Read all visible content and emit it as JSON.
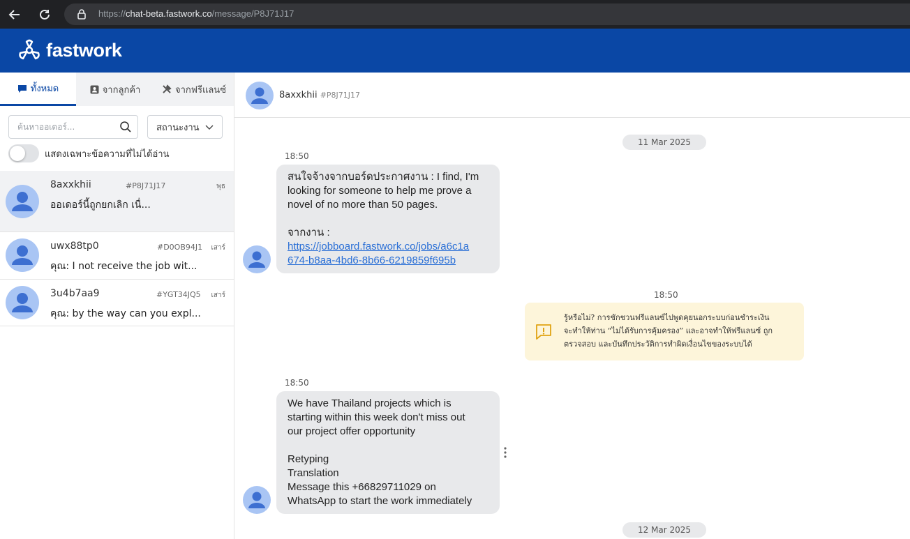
{
  "browser": {
    "url_scheme": "https://",
    "url_host": "chat-beta.fastwork.co",
    "url_path": "/message/P8J71J17"
  },
  "app": {
    "logo_text": "fastwork",
    "brand_color": "#0a47a5"
  },
  "sidebar": {
    "tabs": [
      {
        "label": "ทั้งหมด",
        "icon": "chat-icon",
        "active": true
      },
      {
        "label": "จากลูกค้า",
        "icon": "contact-card-icon",
        "active": false
      },
      {
        "label": "จากฟรีแลนซ์",
        "icon": "tools-icon",
        "active": false
      }
    ],
    "search": {
      "placeholder": "ค้นหาออเดอร์..."
    },
    "status_filter": {
      "selected": "สถานะงาน"
    },
    "unread_toggle": {
      "label": "แสดงเฉพาะข้อความที่ไม่ได้อ่าน",
      "on": false
    },
    "conversations": [
      {
        "name": "8axxkhii",
        "code": "#P8J71J17",
        "day": "พุธ",
        "preview": "ออเดอร์นี้ถูกยกเลิก เนื่...",
        "selected": true
      },
      {
        "name": "uwx88tp0",
        "code": "#D0OB94J1",
        "day": "เสาร์",
        "preview": "คุณ: I not receive the job wit...",
        "selected": false
      },
      {
        "name": "3u4b7aa9",
        "code": "#YGT34JQ5",
        "day": "เสาร์",
        "preview": "คุณ: by the way can you expl...",
        "selected": false
      }
    ]
  },
  "chat": {
    "header": {
      "name": "8axxkhii",
      "code": "#P8J71J17"
    },
    "date_1": "11 Mar 2025",
    "msg_1": {
      "time": "18:50",
      "line_1": "สนใจจ้างจากบอร์ดประกาศงาน : I find, I'm",
      "line_2": "looking for someone to help me prove a",
      "line_3": "novel of no more than 50 pages.",
      "line_4": "จากงาน :",
      "link_1": "https://jobboard.fastwork.co/jobs/a6c1a",
      "link_2": "674-b8aa-4bd6-8b66-6219859f695b"
    },
    "system": {
      "time": "18:50",
      "line_1": "รู้หรือไม่? การชักชวนฟรีแลนซ์ไปพูดคุยนอกระบบก่อนชำระเงิน",
      "line_2": "จะทำให้ท่าน “ไม่ได้รับการคุ้มครอง” และอาจทำให้ฟรีแลนซ์ ถูก",
      "line_3": "ตรวจสอบ และบันทึกประวัติการทำผิดเงื่อนไขของระบบได้"
    },
    "msg_2": {
      "time": "18:50",
      "line_1": "We have Thailand projects which is",
      "line_2": "starting within this week don't miss out",
      "line_3": "our project offer opportunity",
      "line_4": "Retyping",
      "line_5": "Translation",
      "line_6": "Message this +66829711029 on",
      "line_7": "WhatsApp to start the work immediately"
    },
    "date_2": "12 Mar 2025"
  }
}
